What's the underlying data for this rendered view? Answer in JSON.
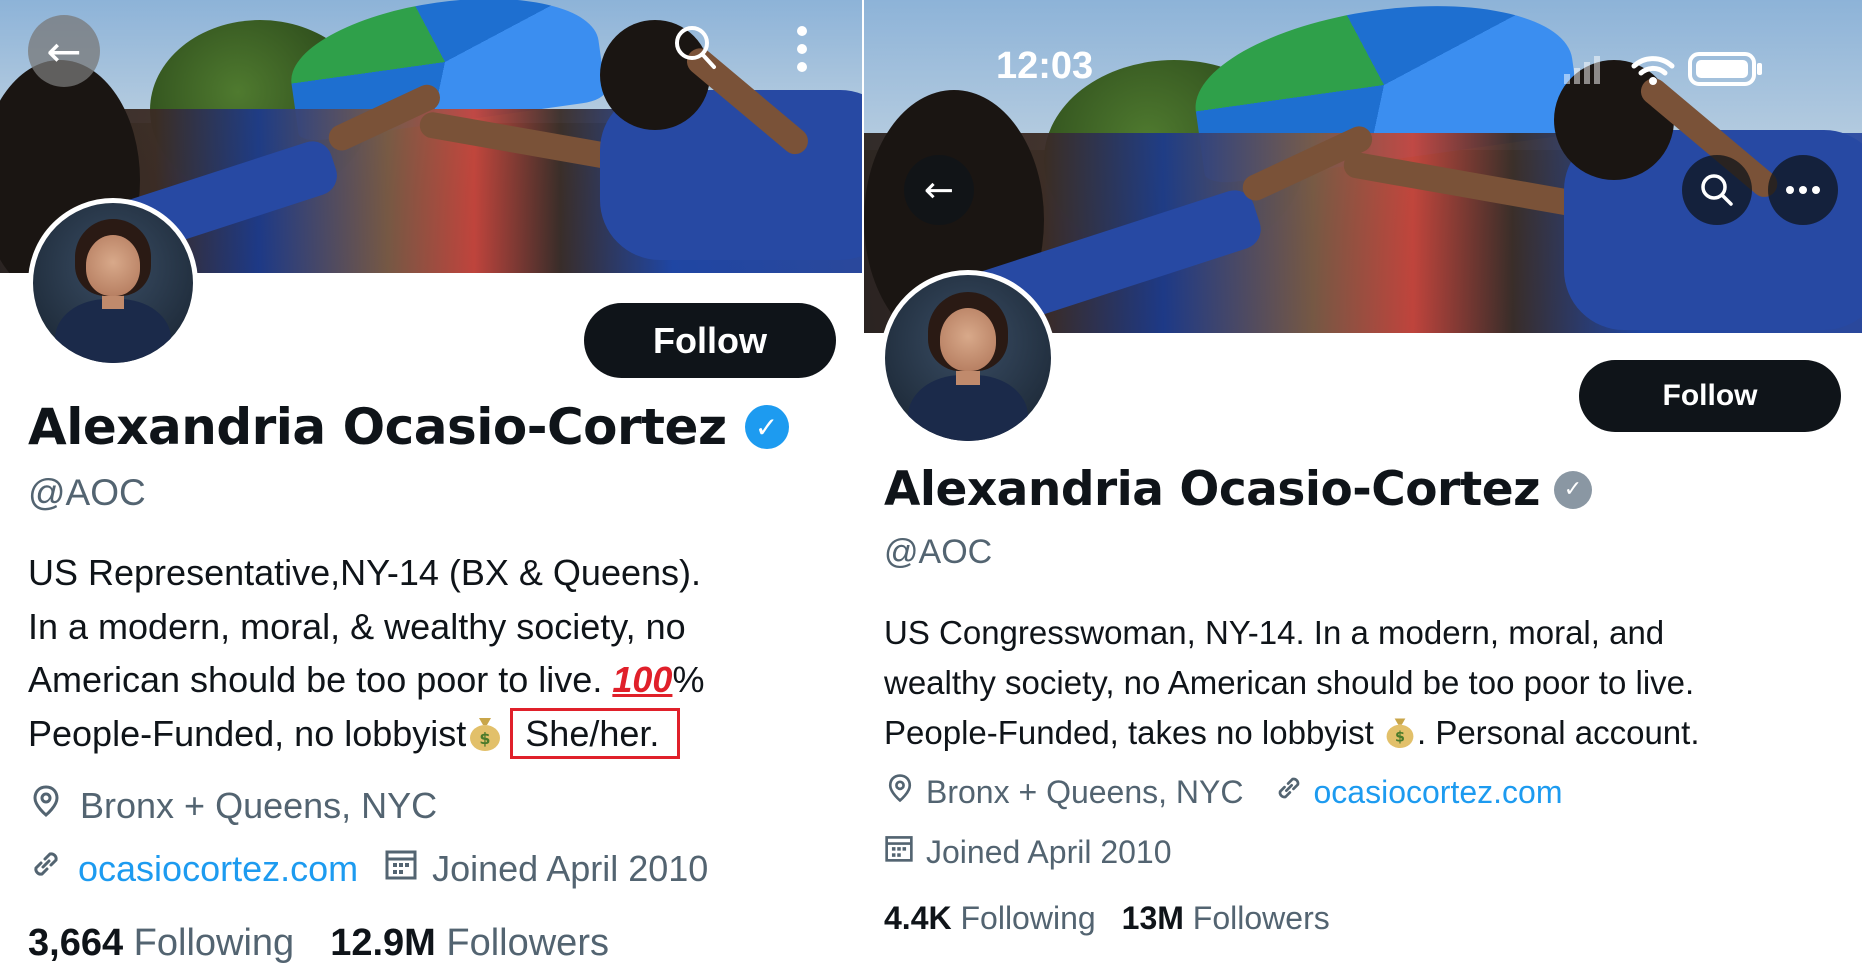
{
  "left": {
    "follow_label": "Follow",
    "display_name": "Alexandria Ocasio-Cortez",
    "verified_color": "#1d9bf0",
    "handle": "@AOC",
    "bio": {
      "line1": "US Representative,NY-14 (BX & Queens).",
      "line2": "In a modern, moral, & wealthy society, no",
      "line3_text": "American should be too poor to live.",
      "line3_hundred": "100",
      "line3_percent": "%",
      "line4_text": "People-Funded, no lobbyist",
      "line4_money_icon": "money-bag-icon",
      "pronouns": "She/her."
    },
    "location": "Bronx + Queens, NYC",
    "website": "ocasiocortez.com",
    "joined": "Joined April 2010",
    "following_count": "3,664",
    "following_label": "Following",
    "followers_count": "12.9M",
    "followers_label": "Followers",
    "highlight_color": "#e0202a"
  },
  "right": {
    "status_time": "12:03",
    "follow_label": "Follow",
    "display_name": "Alexandria Ocasio-Cortez",
    "verified_color": "#8a97a3",
    "handle": "@AOC",
    "bio": {
      "line1": "US Congresswoman, NY-14. In a modern, moral, and",
      "line2": "wealthy society, no American should be too poor to live.",
      "line3_a": "People-Funded, takes no lobbyist",
      "line3_b": ". Personal account.",
      "line3_money_icon": "money-bag-icon"
    },
    "location": "Bronx + Queens, NYC",
    "website": "ocasiocortez.com",
    "joined": "Joined April 2010",
    "following_count": "4.4K",
    "following_label": "Following",
    "followers_count": "13M",
    "followers_label": "Followers"
  },
  "colors": {
    "text": "#0f1419",
    "muted": "#536471",
    "link": "#1d9bf0",
    "button_bg": "#0f1419"
  }
}
